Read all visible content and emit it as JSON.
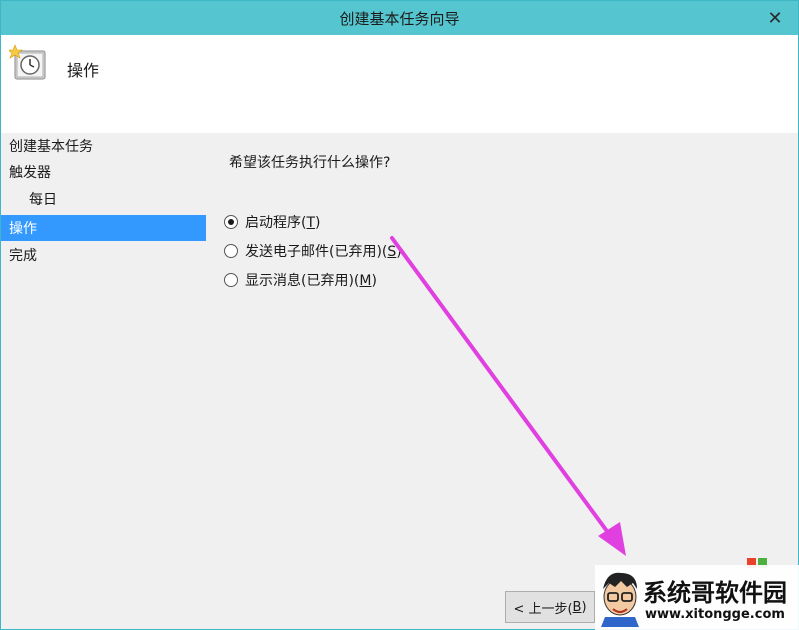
{
  "window": {
    "title": "创建基本任务向导",
    "close_glyph": "✕"
  },
  "header": {
    "heading": "操作",
    "icon": "task-scheduler-clock-icon"
  },
  "sidebar": {
    "items": [
      {
        "label": "创建基本任务"
      },
      {
        "label": "触发器"
      },
      {
        "label": "每日"
      },
      {
        "label": "操作",
        "active": true
      },
      {
        "label": "完成"
      }
    ]
  },
  "main": {
    "question": "希望该任务执行什么操作?",
    "options": [
      {
        "label": "启动程序(",
        "accel": "T",
        "suffix": ")",
        "checked": true
      },
      {
        "label": "发送电子邮件(已弃用)(",
        "accel": "S",
        "suffix": ")",
        "checked": false
      },
      {
        "label": "显示消息(已弃用)(",
        "accel": "M",
        "suffix": ")",
        "checked": false
      }
    ]
  },
  "buttons": {
    "back_prefix": "< 上一步(",
    "back_accel": "B",
    "back_suffix": ")"
  },
  "watermark": {
    "name": "系统哥软件园",
    "url": "www.xitongge.com"
  },
  "colors": {
    "titlebar": "#55c6cf",
    "accent": "#3399ff",
    "arrow": "#e040e0"
  }
}
